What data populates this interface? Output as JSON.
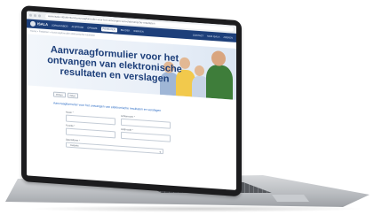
{
  "browser": {
    "url": "www.isala.nl/patienten/aanvraagformulier-voor-het-ontvangen-van-elektronische-resultaten"
  },
  "site": {
    "logo_text": "ISALA",
    "logo_sub": "MEDIWAARDIG",
    "nav": [
      {
        "label": "ZORGAANBOD"
      },
      {
        "label": "AFSPRAAK"
      },
      {
        "label": "OPNAME"
      },
      {
        "label": "PATIËNTEN"
      },
      {
        "label": "BEZOEK"
      },
      {
        "label": "WERKEN"
      }
    ],
    "nav_right": [
      {
        "label": "CONTACT"
      },
      {
        "label": "MIJN ISALA"
      },
      {
        "label": "ZOEKEN"
      }
    ],
    "breadcrumb": "Home  >  Patiënten  >  Aanvraagformulier elektronische resultaten"
  },
  "hero": {
    "title": "Aanvraagformulier voor het ontvangen van elektronische resultaten en verslagen"
  },
  "form": {
    "tools": [
      {
        "label": "Printen"
      },
      {
        "label": "Delen"
      }
    ],
    "subtitle": "Aanvraagformulier voor het ontvangen van elektronische resultaten en verslagen",
    "fields": [
      {
        "label": "Naam *"
      },
      {
        "label": "Achternaam *"
      },
      {
        "label": "Functie *"
      },
      {
        "label": "AGB-code *"
      }
    ],
    "select_label": "Specialisme *",
    "select_value": "Huisarts"
  },
  "colors": {
    "brand": "#1d3f7a",
    "link": "#2c6cc4",
    "screen_bg": "#ffffff",
    "laptop_body": "#1c1c1e",
    "laptop_base": "#c0c3c7"
  }
}
